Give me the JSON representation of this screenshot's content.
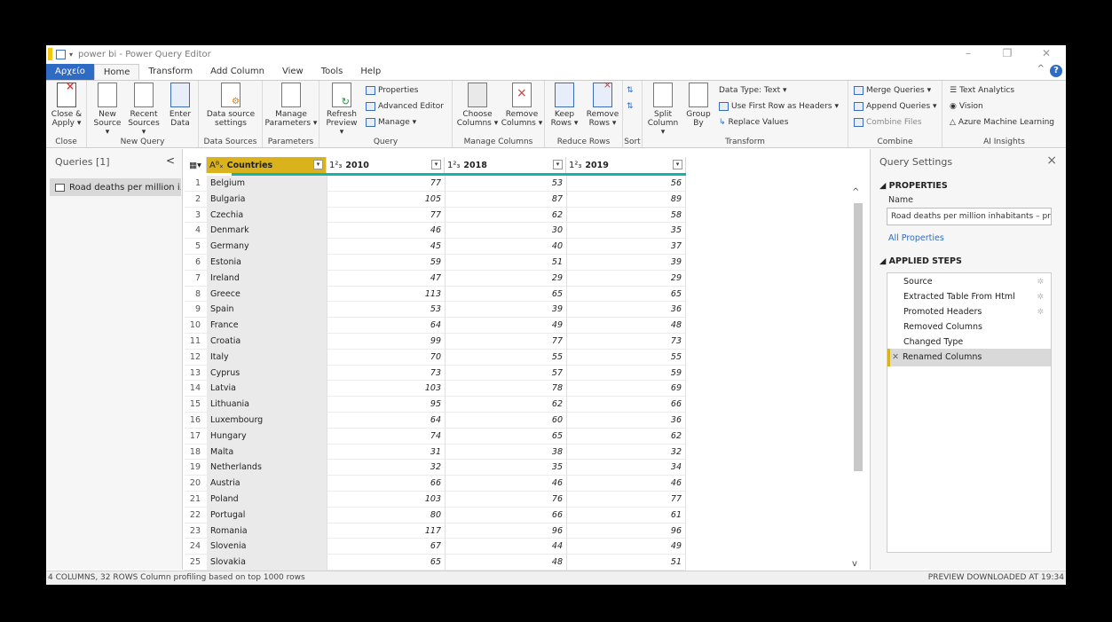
{
  "app": {
    "title": "power bi - Power Query Editor",
    "window_controls": [
      "–",
      "❐",
      "✕"
    ]
  },
  "tabs": [
    {
      "label": "Αρχείο"
    },
    {
      "label": "Home"
    },
    {
      "label": "Transform"
    },
    {
      "label": "Add Column"
    },
    {
      "label": "View"
    },
    {
      "label": "Tools"
    },
    {
      "label": "Help"
    }
  ],
  "ribbon": {
    "close_apply": "Close & Apply ▾",
    "close_group": "Close",
    "new_source": "New Source ▾",
    "recent_sources": "Recent Sources ▾",
    "enter_data": "Enter Data",
    "new_query_group": "New Query",
    "data_source_settings": "Data source settings",
    "data_sources_group": "Data Sources",
    "manage_parameters": "Manage Parameters ▾",
    "parameters_group": "Parameters",
    "refresh_preview": "Refresh Preview ▾",
    "properties": "Properties",
    "advanced_editor": "Advanced Editor",
    "manage": "Manage ▾",
    "query_group": "Query",
    "choose_columns": "Choose Columns ▾",
    "remove_columns": "Remove Columns ▾",
    "manage_columns_group": "Manage Columns",
    "keep_rows": "Keep Rows ▾",
    "remove_rows": "Remove Rows ▾",
    "reduce_rows_group": "Reduce Rows",
    "sort_group": "Sort",
    "split_column": "Split Column ▾",
    "group_by": "Group By",
    "data_type": "Data Type: Text ▾",
    "first_row_headers": "Use First Row as Headers ▾",
    "replace_values": "Replace Values",
    "transform_group": "Transform",
    "merge_queries": "Merge Queries ▾",
    "append_queries": "Append Queries ▾",
    "combine_files": "Combine Files",
    "combine_group": "Combine",
    "text_analytics": "Text Analytics",
    "vision": "Vision",
    "azure_ml": "Azure Machine Learning",
    "ai_group": "AI Insights"
  },
  "queries": {
    "header": "Queries [1]",
    "items": [
      {
        "label": "Road deaths per million i..."
      }
    ]
  },
  "grid": {
    "columns": [
      {
        "type": "Aᴮₓ",
        "label": "Countries"
      },
      {
        "type": "1²₃",
        "label": "2010"
      },
      {
        "type": "1²₃",
        "label": "2018"
      },
      {
        "type": "1²₃",
        "label": "2019"
      }
    ],
    "rows": [
      [
        "1",
        "Belgium",
        "77",
        "53",
        "56"
      ],
      [
        "2",
        "Bulgaria",
        "105",
        "87",
        "89"
      ],
      [
        "3",
        "Czechia",
        "77",
        "62",
        "58"
      ],
      [
        "4",
        "Denmark",
        "46",
        "30",
        "35"
      ],
      [
        "5",
        "Germany",
        "45",
        "40",
        "37"
      ],
      [
        "6",
        "Estonia",
        "59",
        "51",
        "39"
      ],
      [
        "7",
        "Ireland",
        "47",
        "29",
        "29"
      ],
      [
        "8",
        "Greece",
        "113",
        "65",
        "65"
      ],
      [
        "9",
        "Spain",
        "53",
        "39",
        "36"
      ],
      [
        "10",
        "France",
        "64",
        "49",
        "48"
      ],
      [
        "11",
        "Croatia",
        "99",
        "77",
        "73"
      ],
      [
        "12",
        "Italy",
        "70",
        "55",
        "55"
      ],
      [
        "13",
        "Cyprus",
        "73",
        "57",
        "59"
      ],
      [
        "14",
        "Latvia",
        "103",
        "78",
        "69"
      ],
      [
        "15",
        "Lithuania",
        "95",
        "62",
        "66"
      ],
      [
        "16",
        "Luxembourg",
        "64",
        "60",
        "36"
      ],
      [
        "17",
        "Hungary",
        "74",
        "65",
        "62"
      ],
      [
        "18",
        "Malta",
        "31",
        "38",
        "32"
      ],
      [
        "19",
        "Netherlands",
        "32",
        "35",
        "34"
      ],
      [
        "20",
        "Austria",
        "66",
        "46",
        "46"
      ],
      [
        "21",
        "Poland",
        "103",
        "76",
        "77"
      ],
      [
        "22",
        "Portugal",
        "80",
        "66",
        "61"
      ],
      [
        "23",
        "Romania",
        "117",
        "96",
        "96"
      ],
      [
        "24",
        "Slovenia",
        "67",
        "44",
        "49"
      ],
      [
        "25",
        "Slovakia",
        "65",
        "48",
        "51"
      ]
    ]
  },
  "settings": {
    "title": "Query Settings",
    "properties_header": "PROPERTIES",
    "name_label": "Name",
    "name_value": "Road deaths per million inhabitants – pre",
    "all_properties": "All Properties",
    "applied_steps_header": "APPLIED STEPS",
    "steps": [
      {
        "label": "Source"
      },
      {
        "label": "Extracted Table From Html"
      },
      {
        "label": "Promoted Headers"
      },
      {
        "label": "Removed Columns"
      },
      {
        "label": "Changed Type"
      },
      {
        "label": "Renamed Columns"
      }
    ]
  },
  "status": {
    "left": "4 COLUMNS, 32 ROWS    Column profiling based on top 1000 rows",
    "right": "PREVIEW DOWNLOADED AT 19:34"
  },
  "colors": {
    "accent": "#2d6bc4",
    "selected_column": "#d9b21c",
    "quality_bar": "#19b3a6"
  }
}
